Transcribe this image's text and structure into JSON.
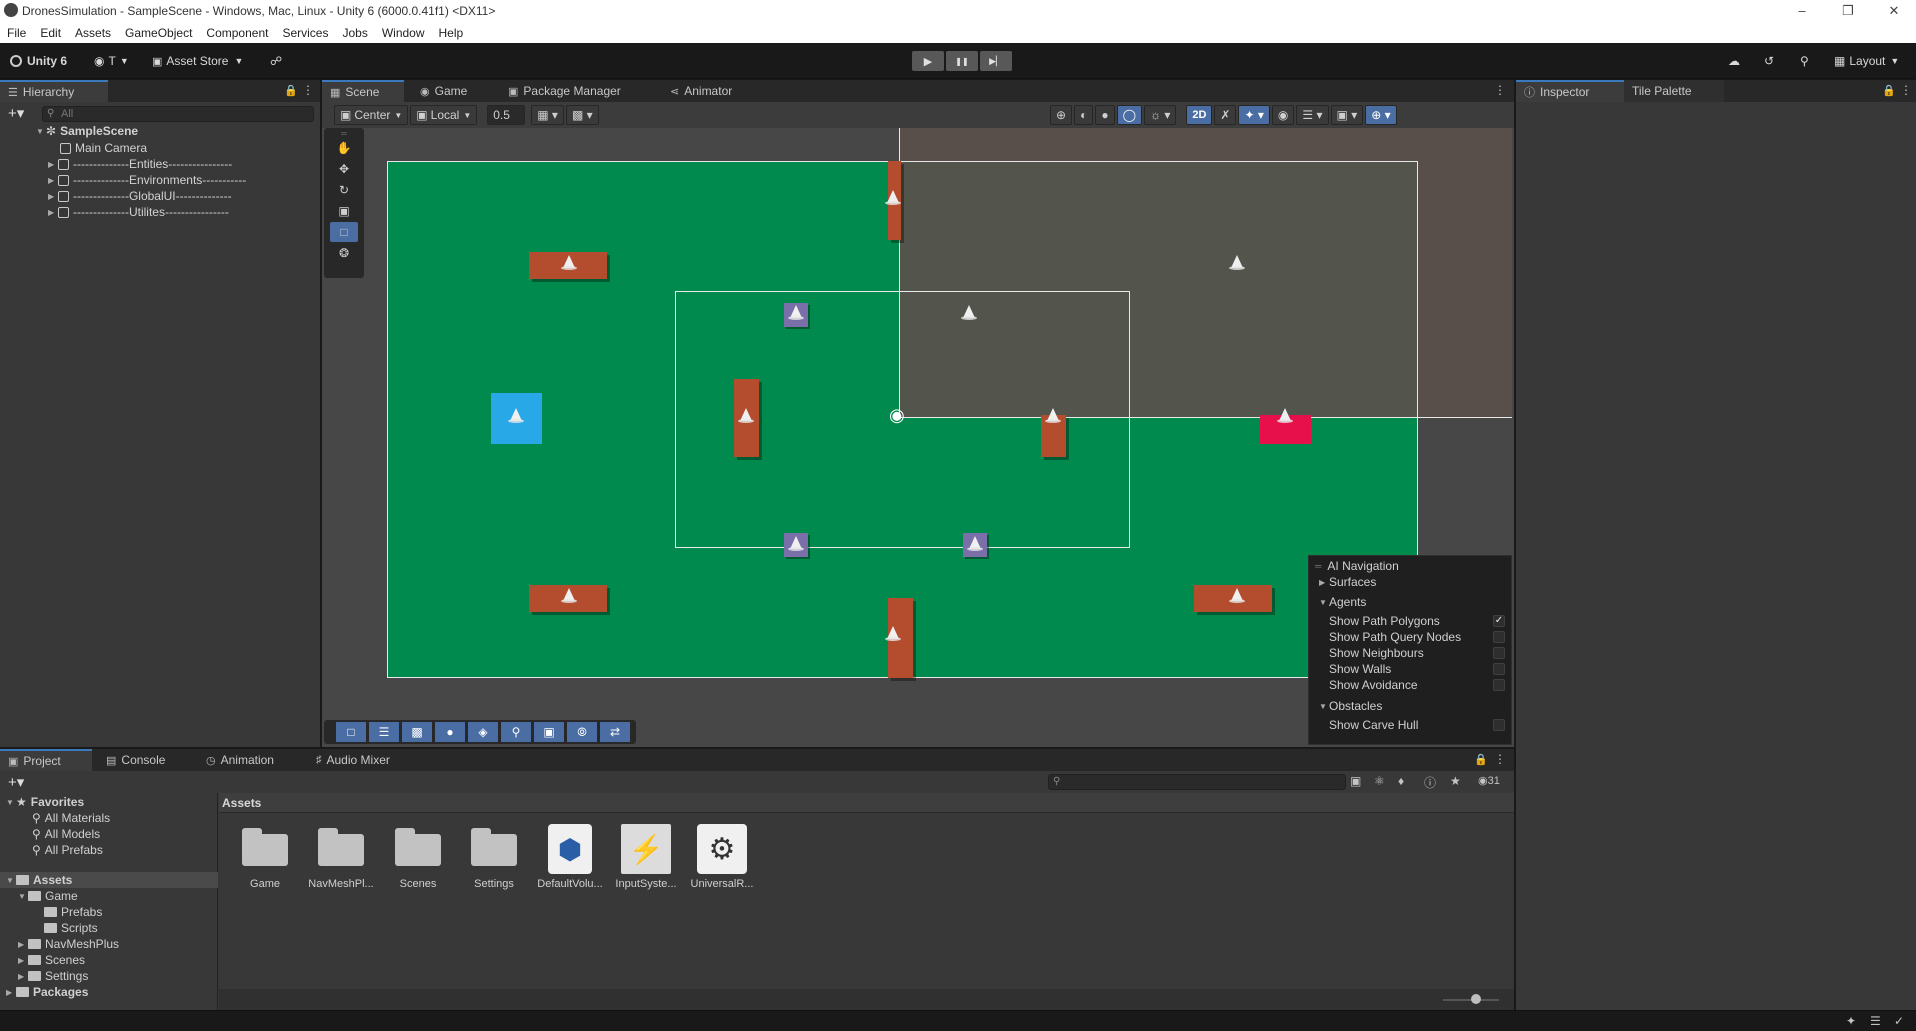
{
  "window": {
    "title": "DronesSimulation - SampleScene - Windows, Mac, Linux - Unity 6 (6000.0.41f1) <DX11>",
    "controls": [
      "–",
      "❐",
      "✕"
    ]
  },
  "menu": [
    "File",
    "Edit",
    "Assets",
    "GameObject",
    "Component",
    "Services",
    "Jobs",
    "Window",
    "Help"
  ],
  "toolbar": {
    "account": "Unity 6",
    "user": "T",
    "asset_store": "Asset Store",
    "layout": "Layout",
    "play": "▶",
    "pause": "❚❚",
    "step": "▶▏"
  },
  "hierarchy": {
    "tab": "Hierarchy",
    "search_placeholder": "All",
    "scene": "SampleScene",
    "items": [
      "Main Camera",
      "--------------Entities----------------",
      "--------------Environments-----------",
      "--------------GlobalUI--------------",
      "--------------Utilites----------------"
    ]
  },
  "scene_tabs": [
    "Scene",
    "Game",
    "Package Manager",
    "Animator"
  ],
  "scene_toolbar": {
    "pivot": "Center",
    "space": "Local",
    "snap": "0.5",
    "mode2d": "2D"
  },
  "inspector_tabs": [
    "Inspector",
    "Tile Palette"
  ],
  "ai_navigation": {
    "title": "AI Navigation",
    "surfaces": "Surfaces",
    "agents": "Agents",
    "agent_options": [
      {
        "label": "Show Path Polygons",
        "checked": true
      },
      {
        "label": "Show Path Query Nodes",
        "checked": false
      },
      {
        "label": "Show Neighbours",
        "checked": false
      },
      {
        "label": "Show Walls",
        "checked": false
      },
      {
        "label": "Show Avoidance",
        "checked": false
      }
    ],
    "obstacles": "Obstacles",
    "obstacle_options": [
      {
        "label": "Show Carve Hull",
        "checked": false
      }
    ]
  },
  "bottom_tabs": [
    "Project",
    "Console",
    "Animation",
    "Audio Mixer"
  ],
  "project": {
    "favorites_label": "Favorites",
    "favorites": [
      "All Materials",
      "All Models",
      "All Prefabs"
    ],
    "assets_label": "Assets",
    "tree": [
      {
        "label": "Game",
        "depth": 1,
        "open": true
      },
      {
        "label": "Prefabs",
        "depth": 2,
        "open": false
      },
      {
        "label": "Scripts",
        "depth": 2,
        "open": false
      },
      {
        "label": "NavMeshPlus",
        "depth": 1,
        "open": false
      },
      {
        "label": "Scenes",
        "depth": 1,
        "open": false
      },
      {
        "label": "Settings",
        "depth": 1,
        "open": false
      }
    ],
    "packages_label": "Packages",
    "breadcrumb": "Assets",
    "hidden_count": "31",
    "items": [
      {
        "label": "Game",
        "kind": "folder"
      },
      {
        "label": "NavMeshPl...",
        "kind": "folder"
      },
      {
        "label": "Scenes",
        "kind": "folder"
      },
      {
        "label": "Settings",
        "kind": "folder"
      },
      {
        "label": "DefaultVolu...",
        "kind": "volume"
      },
      {
        "label": "InputSyste...",
        "kind": "input"
      },
      {
        "label": "UniversalR...",
        "kind": "settings"
      }
    ]
  },
  "colors": {
    "ground": "#008a4e",
    "wall": "#b44c2e",
    "drone_blue": "#29a8e8",
    "drone_red": "#e8104a",
    "station": "#7a6fa8",
    "accent": "#3a79bb"
  }
}
